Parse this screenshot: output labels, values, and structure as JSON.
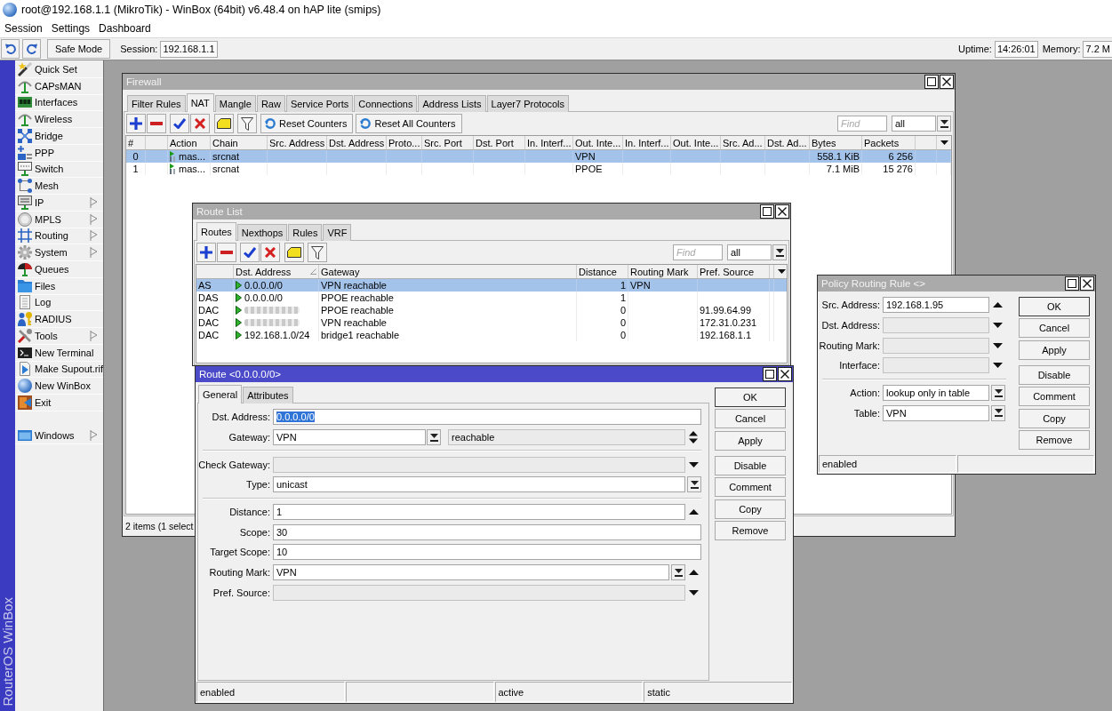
{
  "window": {
    "title": "root@192.168.1.1 (MikroTik) - WinBox (64bit) v6.48.4 on hAP lite (smips)"
  },
  "menu": [
    "Session",
    "Settings",
    "Dashboard"
  ],
  "toolbar": {
    "safe_mode": "Safe Mode",
    "session_label": "Session:",
    "session_value": "192.168.1.1",
    "uptime_label": "Uptime:",
    "uptime_value": "14:26:01",
    "memory_label": "Memory:",
    "memory_value": "7.2 M"
  },
  "side_banner": "RouterOS WinBox",
  "sidebar": {
    "groups": [
      {
        "items": [
          {
            "label": "Quick Set",
            "submenu": false
          },
          {
            "label": "CAPsMAN",
            "submenu": false
          },
          {
            "label": "Interfaces",
            "submenu": false
          },
          {
            "label": "Wireless",
            "submenu": false
          },
          {
            "label": "Bridge",
            "submenu": false
          },
          {
            "label": "PPP",
            "submenu": false
          },
          {
            "label": "Switch",
            "submenu": false
          },
          {
            "label": "Mesh",
            "submenu": false
          },
          {
            "label": "IP",
            "submenu": true
          },
          {
            "label": "MPLS",
            "submenu": true
          },
          {
            "label": "Routing",
            "submenu": true
          },
          {
            "label": "System",
            "submenu": true
          },
          {
            "label": "Queues",
            "submenu": false
          },
          {
            "label": "Files",
            "submenu": false
          },
          {
            "label": "Log",
            "submenu": false
          },
          {
            "label": "RADIUS",
            "submenu": false
          },
          {
            "label": "Tools",
            "submenu": true
          },
          {
            "label": "New Terminal",
            "submenu": false
          },
          {
            "label": "Make Supout.rif",
            "submenu": false
          },
          {
            "label": "New WinBox",
            "submenu": false
          },
          {
            "label": "Exit",
            "submenu": false
          }
        ]
      },
      {
        "items": [
          {
            "label": "Windows",
            "submenu": true
          }
        ]
      }
    ]
  },
  "firewall": {
    "title": "Firewall",
    "active": false,
    "tabs": [
      {
        "label": "Filter Rules",
        "selected": false
      },
      {
        "label": "NAT",
        "selected": true
      },
      {
        "label": "Mangle",
        "selected": false
      },
      {
        "label": "Raw",
        "selected": false
      },
      {
        "label": "Service Ports",
        "selected": false
      },
      {
        "label": "Connections",
        "selected": false
      },
      {
        "label": "Address Lists",
        "selected": false
      },
      {
        "label": "Layer7 Protocols",
        "selected": false
      }
    ],
    "toolbar": {
      "buttons": [
        "Reset Counters",
        "Reset All Counters"
      ],
      "find_placeholder": "Find",
      "filter": "all"
    },
    "table": {
      "columns": [
        "#",
        "Action",
        "Chain",
        "Src. Address",
        "Dst. Address",
        "Proto...",
        "Src. Port",
        "Dst. Port",
        "In. Interf...",
        "Out. Inte...",
        "In. Interf...",
        "Out. Inte...",
        "Src. Ad...",
        "Dst. Ad...",
        "Bytes",
        "Packets"
      ],
      "rows": [
        {
          "number": "0",
          "action": "mas...",
          "chain": "srcnat",
          "out_interface": "VPN",
          "bytes": "558.1 KiB",
          "packets": "6 256",
          "selected": true
        },
        {
          "number": "1",
          "action": "mas...",
          "chain": "srcnat",
          "out_interface": "PPOE",
          "bytes": "7.1 MiB",
          "packets": "15 276",
          "selected": false
        }
      ]
    },
    "status": {
      "column_1": "2 items (1 select"
    }
  },
  "route_list": {
    "title": "Route List",
    "active": false,
    "tabs": [
      {
        "label": "Routes",
        "selected": true
      },
      {
        "label": "Nexthops",
        "selected": false
      },
      {
        "label": "Rules",
        "selected": false
      },
      {
        "label": "VRF",
        "selected": false
      }
    ],
    "toolbar": {
      "find_placeholder": "Find",
      "filter": "all"
    },
    "table": {
      "columns": [
        {
          "label": "Dst. Address",
          "sorted": true
        },
        {
          "label": "Gateway",
          "sorted": false
        },
        {
          "label": "Distance",
          "sorted": false
        },
        {
          "label": "Routing Mark",
          "sorted": false
        },
        {
          "label": "Pref. Source",
          "sorted": false
        }
      ],
      "rows": [
        {
          "flags": "AS",
          "dst_address": "0.0.0.0/0",
          "redacted": false,
          "gateway": "VPN reachable",
          "distance": "1",
          "routing_mark": "VPN",
          "selected": true
        },
        {
          "flags": "DAS",
          "dst_address": "0.0.0.0/0",
          "redacted": false,
          "gateway": "PPOE reachable",
          "distance": "1",
          "selected": false
        },
        {
          "flags": "DAC",
          "redacted": true,
          "gateway": "PPOE reachable",
          "distance": "0",
          "pref_source": "91.99.64.99",
          "selected": false
        },
        {
          "flags": "DAC",
          "redacted": true,
          "gateway": "VPN reachable",
          "distance": "0",
          "pref_source": "172.31.0.231",
          "selected": false
        },
        {
          "flags": "DAC",
          "dst_address": "192.168.1.0/24",
          "redacted": false,
          "gateway": "bridge1 reachable",
          "distance": "0",
          "pref_source": "192.168.1.1",
          "selected": false
        }
      ]
    }
  },
  "policy_rule": {
    "title": "Policy Routing Rule <>",
    "active": false,
    "groups": [
      {
        "fields": [
          {
            "label": "Src. Address:",
            "value": "192.168.1.95",
            "text_selected": false,
            "disabled": false,
            "dropdown": false,
            "kind": "up"
          },
          {
            "label": "Dst. Address:",
            "disabled": true,
            "dropdown": false,
            "kind": "down"
          },
          {
            "label": "Routing Mark:",
            "disabled": true,
            "dropdown": false,
            "kind": "down"
          },
          {
            "label": "Interface:",
            "disabled": true,
            "dropdown": false,
            "kind": "down"
          }
        ]
      },
      {
        "fields": [
          {
            "label": "Action:",
            "value": "lookup only in table",
            "text_selected": false,
            "disabled": false,
            "dropdown": true,
            "kind": "none"
          },
          {
            "label": "Table:",
            "value": "VPN",
            "text_selected": false,
            "disabled": false,
            "dropdown": true,
            "kind": "none"
          }
        ]
      }
    ],
    "button_groups": [
      {
        "buttons": [
          {
            "label": "OK",
            "default": true
          },
          {
            "label": "Cancel",
            "default": false
          },
          {
            "label": "Apply",
            "default": false
          }
        ]
      },
      {
        "buttons": [
          {
            "label": "Disable",
            "default": false
          },
          {
            "label": "Comment",
            "default": false
          },
          {
            "label": "Copy",
            "default": false
          },
          {
            "label": "Remove",
            "default": false
          }
        ]
      }
    ],
    "status": {
      "column_1": "enabled"
    }
  },
  "route": {
    "title": "Route <0.0.0.0/0>",
    "active": true,
    "tabs": [
      {
        "label": "General",
        "selected": true
      },
      {
        "label": "Attributes",
        "selected": false
      }
    ],
    "groups": [
      {
        "fields": [
          {
            "label": "Dst. Address:",
            "value": "0.0.0.0/0",
            "text_selected": true,
            "disabled": false,
            "dropdown": false,
            "kind": "none"
          },
          {
            "label": "Gateway:",
            "value": "VPN",
            "text_selected": false,
            "disabled": false,
            "dropdown": true,
            "extra": {
              "value": "reachable",
              "disabled": true
            },
            "kind": "updown"
          }
        ]
      },
      {
        "fields": [
          {
            "label": "Check Gateway:",
            "disabled": true,
            "dropdown": false,
            "kind": "down"
          },
          {
            "label": "Type:",
            "value": "unicast",
            "text_selected": false,
            "disabled": false,
            "dropdown": true,
            "kind": "none"
          }
        ]
      },
      {
        "fields": [
          {
            "label": "Distance:",
            "value": "1",
            "text_selected": false,
            "disabled": false,
            "dropdown": false,
            "kind": "up"
          },
          {
            "label": "Scope:",
            "value": "30",
            "text_selected": false,
            "disabled": false,
            "dropdown": false,
            "kind": "none"
          },
          {
            "label": "Target Scope:",
            "value": "10",
            "text_selected": false,
            "disabled": false,
            "dropdown": false,
            "kind": "none"
          },
          {
            "label": "Routing Mark:",
            "value": "VPN",
            "text_selected": false,
            "disabled": false,
            "dropdown": true,
            "kind": "up"
          },
          {
            "label": "Pref. Source:",
            "disabled": true,
            "dropdown": false,
            "kind": "down"
          }
        ]
      }
    ],
    "button_groups": [
      {
        "buttons": [
          {
            "label": "OK",
            "default": true
          },
          {
            "label": "Cancel",
            "default": false
          },
          {
            "label": "Apply",
            "default": false
          }
        ]
      },
      {
        "buttons": [
          {
            "label": "Disable",
            "default": false
          },
          {
            "label": "Comment",
            "default": false
          },
          {
            "label": "Copy",
            "default": false
          },
          {
            "label": "Remove",
            "default": false
          }
        ]
      }
    ],
    "status": {
      "column_1": "enabled",
      "column_3": "active",
      "column_4": "static"
    }
  }
}
